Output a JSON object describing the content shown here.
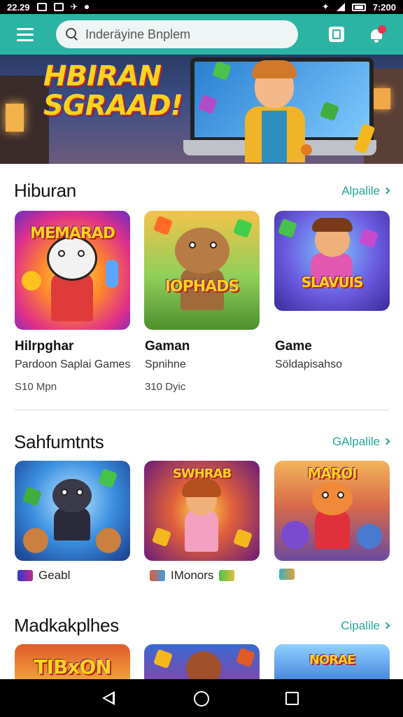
{
  "status_bar": {
    "time_left": "22.29",
    "time_right": "7:200"
  },
  "search": {
    "placeholder": "Inderäyine Bnplem"
  },
  "hero": {
    "title_line1": "HBIRAN",
    "title_line2": "SGRAAD!"
  },
  "sections": [
    {
      "title": "Hiburan",
      "see_all": "Alpalile",
      "cards": [
        {
          "art_text": "MEMARAD",
          "name": "Hilrpghar",
          "subtitle": "Pardoon Saplai Games",
          "price": "S10 Mpn"
        },
        {
          "art_text": "IOPHADS",
          "name": "Gaman",
          "subtitle": "Spnihne",
          "price": "310 Dyic"
        },
        {
          "art_text": "SLAVUIS",
          "name": "Game",
          "subtitle": "Söldapisahso",
          "price": ""
        }
      ]
    },
    {
      "title": "Sahfumtnts",
      "see_all": "GAlpalile",
      "cards": [
        {
          "art_text": "",
          "tag": "Geabl"
        },
        {
          "art_text": "SWHRAB",
          "tag": "IMonors"
        },
        {
          "art_text": "MAROI",
          "tag": ""
        }
      ]
    },
    {
      "title": "Madkakplhes",
      "see_all": "Cipalile",
      "cards": [
        {
          "art_text": "TIBxON"
        },
        {
          "art_text": ""
        },
        {
          "art_text": "NORAE"
        }
      ]
    }
  ],
  "colors": {
    "accent": "#2bb3a3",
    "see_all": "#23a596",
    "badge": "#e8334a"
  },
  "icons": [
    "menu-icon",
    "search-icon",
    "store-icon",
    "notification-bell-icon",
    "back-icon",
    "home-icon",
    "recents-icon"
  ]
}
